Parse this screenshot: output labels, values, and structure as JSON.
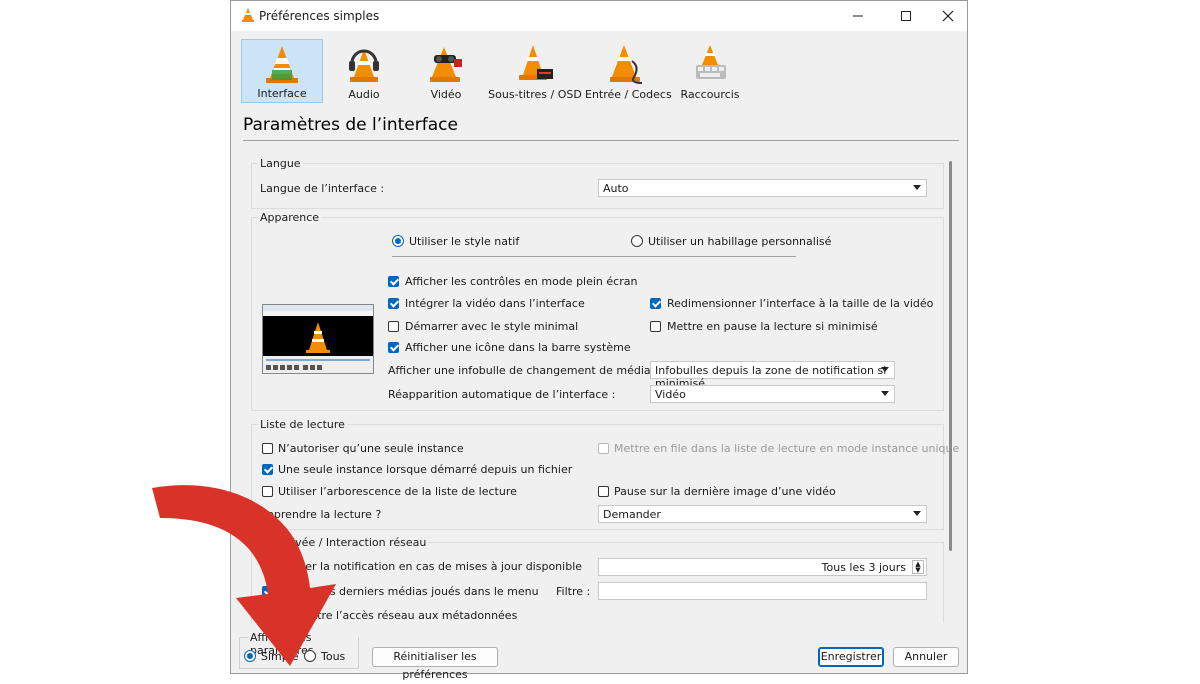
{
  "window": {
    "title": "Préférences simples"
  },
  "toolbar": {
    "items": [
      {
        "label": "Interface",
        "active": true,
        "icon": "interface-cone-icon"
      },
      {
        "label": "Audio",
        "active": false,
        "icon": "audio-headphones-cone-icon"
      },
      {
        "label": "Vidéo",
        "active": false,
        "icon": "video-cone-icon"
      },
      {
        "label": "Sous-titres / OSD",
        "active": false,
        "icon": "subtitles-cone-icon"
      },
      {
        "label": "Entrée / Codecs",
        "active": false,
        "icon": "codecs-cone-icon"
      },
      {
        "label": "Raccourcis",
        "active": false,
        "icon": "hotkeys-cone-icon"
      }
    ]
  },
  "page": {
    "heading": "Paramètres de l’interface"
  },
  "langue": {
    "legend": "Langue",
    "label": "Langue de l’interface :",
    "value": "Auto"
  },
  "apparence": {
    "legend": "Apparence",
    "radio_native": "Utiliser le style natif",
    "radio_native_selected": true,
    "radio_skin": "Utiliser un habillage personnalisé",
    "cb_fullscreen": "Afficher les contrôles en mode plein écran",
    "cb_integrate": "Intégrer la vidéo dans l’interface",
    "cb_resize": "Redimensionner l’interface à la taille de la vidéo",
    "cb_minimal": "Démarrer avec le style minimal",
    "cb_pause_min": "Mettre en pause la lecture si minimisé",
    "cb_systray": "Afficher une icône dans la barre système",
    "notif_label": "Afficher une infobulle de changement de média :",
    "notif_value": "Infobulles depuis la zone de notification si minimisé",
    "raise_label": "Réapparition automatique de l’interface :",
    "raise_value": "Vidéo"
  },
  "playlist": {
    "legend": "Liste de lecture",
    "cb_one_instance": "N’autoriser qu’une seule instance",
    "cb_enqueue": "Mettre en file dans la liste de lecture en mode instance unique",
    "cb_one_instance_file": "Une seule instance lorsque démarré depuis un fichier",
    "cb_tree": "Utiliser l’arborescence de la liste de lecture",
    "cb_pause_last": "Pause sur la dernière image d’une vidéo",
    "resume_label": "Reprendre la lecture ?",
    "resume_value": "Demander"
  },
  "privacy": {
    "legend": "Vie privée / Interaction réseau",
    "update_label": "Activer la notification en cas de mises à jour disponible",
    "update_value": "Tous les 3 jours",
    "recent_label": "Sauver les derniers médias joués dans le menu",
    "filter_label": "Filtre :",
    "meta_label": "Permettre l’accès réseau aux métadonnées"
  },
  "footer": {
    "show_legend": "Afficher les paramètres",
    "radio_simple": "Simple",
    "radio_all": "Tous",
    "reset": "Réinitialiser les préférences",
    "save": "Enregistrer",
    "cancel": "Annuler"
  },
  "colors": {
    "accent": "#0067c0",
    "overlay_arrow": "#d93329"
  }
}
